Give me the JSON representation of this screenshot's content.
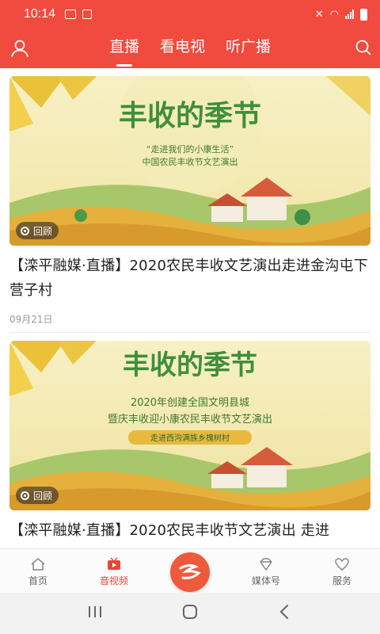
{
  "status_bar": {
    "time": "10:14"
  },
  "header": {
    "tabs": [
      {
        "label": "直播",
        "active": true
      },
      {
        "label": "看电视",
        "active": false
      },
      {
        "label": "听广播",
        "active": false
      }
    ]
  },
  "feed": {
    "items": [
      {
        "badge": "回顾",
        "title": "【滦平融媒·直播】2020农民丰收文艺演出走进金沟屯下营子村",
        "date": "09月21日"
      },
      {
        "badge": "回顾",
        "title": "【滦平融媒·直播】2020农民丰收节文艺演出 走进",
        "date": ""
      }
    ]
  },
  "bottom_nav": {
    "items": [
      {
        "label": "首页",
        "icon": "home-icon"
      },
      {
        "label": "音视频",
        "icon": "video-icon",
        "active": true
      },
      {
        "label": "媒体号",
        "icon": "diamond-icon"
      },
      {
        "label": "服务",
        "icon": "heart-icon"
      }
    ]
  },
  "colors": {
    "brand_red": "#f14a3e",
    "active_tab": "#e8463a",
    "center_button": "#ee5a3c"
  }
}
